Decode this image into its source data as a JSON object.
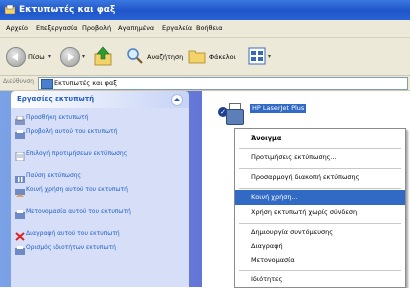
{
  "window": {
    "title": "Εκτυπωτές και φαξ"
  },
  "menubar": {
    "items": [
      "Αρχείο",
      "Επεξεργασία",
      "Προβολή",
      "Αγαπημένα",
      "Εργαλεία",
      "Βοήθεια"
    ]
  },
  "toolbar": {
    "back_label": "Πίσω",
    "search_label": "Αναζήτηση",
    "folders_label": "Φάκελοι"
  },
  "address": {
    "label": "Διεύθυνση",
    "value": "Εκτυπωτές και φαξ"
  },
  "task_pane": {
    "header": "Εργασίες εκτυπωτή",
    "tasks": [
      "Προσθήκη εκτυπωτή",
      "Προβολή αυτού του εκτυπωτή",
      "Επιλογή προτιμήσεων εκτύπωσης",
      "Παύση εκτύπωσης",
      "Κοινή χρήση αυτού του εκτυπωτή",
      "Μετονομασία αυτού του εκτυπωτή",
      "Διαγραφή αυτού του εκτυπωτή",
      "Ορισμός ιδιοτήτων εκτυπωτή"
    ]
  },
  "main": {
    "printer_name": "HP LaserJet Plus"
  },
  "context_menu": {
    "items": [
      "Άνοιγμα",
      "Προτιμήσεις εκτύπωσης...",
      "Προσαρμογή διακοπή εκτύπωσης",
      "Κοινή χρήση...",
      "Χρήση εκτυπωτή χωρίς σύνδεση",
      "Δημιουργία συντόμευσης",
      "Διαγραφή",
      "Μετονομασία",
      "Ιδιότητες"
    ],
    "highlighted_index": 3
  },
  "colors": {
    "titlebar": "#2a62d6",
    "task_pane": "#6d8bdc",
    "highlight": "#316ac5"
  }
}
